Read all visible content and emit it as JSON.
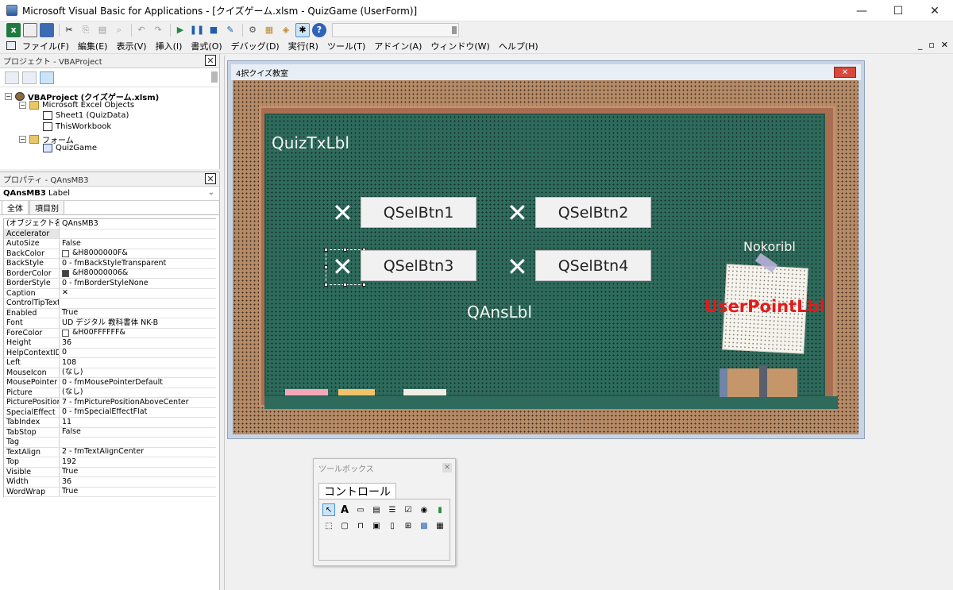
{
  "window": {
    "title": "Microsoft Visual Basic for Applications - [クイズゲーム.xlsm - QuizGame (UserForm)]",
    "controls": [
      "—",
      "☐",
      "✕"
    ]
  },
  "menu": {
    "items": [
      "ファイル(F)",
      "編集(E)",
      "表示(V)",
      "挿入(I)",
      "書式(O)",
      "デバッグ(D)",
      "実行(R)",
      "ツール(T)",
      "アドイン(A)",
      "ウィンドウ(W)",
      "ヘルプ(H)"
    ],
    "mdi_controls": [
      "_",
      "▫",
      "✕"
    ]
  },
  "project": {
    "title": "プロジェクト - VBAProject",
    "close": "✕",
    "root": "VBAProject (クイズゲーム.xlsm)",
    "excel_objects": "Microsoft Excel Objects",
    "sheet1": "Sheet1 (QuizData)",
    "workbook": "ThisWorkbook",
    "forms_folder": "フォーム",
    "form": "QuizGame"
  },
  "properties": {
    "title": "プロパティ - QAnsMB3",
    "close": "✕",
    "object_name": "QAnsMB3",
    "object_type": "Label",
    "tabs": [
      "全体",
      "項目別"
    ],
    "rows": [
      {
        "name": "(オブジェクト名)",
        "value": "QAnsMB3"
      },
      {
        "name": "Accelerator",
        "value": ""
      },
      {
        "name": "AutoSize",
        "value": "False"
      },
      {
        "name": "BackColor",
        "value": "&H8000000F&",
        "swatch": "#ffffff"
      },
      {
        "name": "BackStyle",
        "value": "0 - fmBackStyleTransparent"
      },
      {
        "name": "BorderColor",
        "value": "&H80000006&",
        "swatch": "#444444"
      },
      {
        "name": "BorderStyle",
        "value": "0 - fmBorderStyleNone"
      },
      {
        "name": "Caption",
        "value": "✕"
      },
      {
        "name": "ControlTipText",
        "value": ""
      },
      {
        "name": "Enabled",
        "value": "True"
      },
      {
        "name": "Font",
        "value": "UD デジタル 教科書体 NK-B"
      },
      {
        "name": "ForeColor",
        "value": "&H00FFFFFF&",
        "swatch": "#ffffff"
      },
      {
        "name": "Height",
        "value": "36"
      },
      {
        "name": "HelpContextID",
        "value": "0"
      },
      {
        "name": "Left",
        "value": "108"
      },
      {
        "name": "MouseIcon",
        "value": "(なし)"
      },
      {
        "name": "MousePointer",
        "value": "0 - fmMousePointerDefault"
      },
      {
        "name": "Picture",
        "value": "(なし)"
      },
      {
        "name": "PicturePosition",
        "value": "7 - fmPicturePositionAboveCenter"
      },
      {
        "name": "SpecialEffect",
        "value": "0 - fmSpecialEffectFlat"
      },
      {
        "name": "TabIndex",
        "value": "11"
      },
      {
        "name": "TabStop",
        "value": "False"
      },
      {
        "name": "Tag",
        "value": ""
      },
      {
        "name": "TextAlign",
        "value": "2 - fmTextAlignCenter"
      },
      {
        "name": "Top",
        "value": "192"
      },
      {
        "name": "Visible",
        "value": "True"
      },
      {
        "name": "Width",
        "value": "36"
      },
      {
        "name": "WordWrap",
        "value": "True"
      }
    ]
  },
  "designer": {
    "title": "4択クイズ教室",
    "close": "✕",
    "quiz_label": "QuizTxLbl",
    "answer_label": "QAnsLbl",
    "mark": "✕",
    "buttons": [
      "QSelBtn1",
      "QSelBtn2",
      "QSelBtn3",
      "QSelBtn4"
    ],
    "nokori_label": "Nokoribl",
    "user_point_label": "UserPointLbl",
    "colors": {
      "board": "#2f6b5c",
      "frame": "#a86e52",
      "user_point": "#e21b1b"
    }
  },
  "toolbox": {
    "title": "ツールボックス",
    "close": "✕",
    "tab": "コントロール",
    "controls_row1": [
      "pointer-icon",
      "label-icon",
      "textbox-icon",
      "combobox-icon",
      "listbox-icon",
      "checkbox-icon",
      "optionbutton-icon",
      "togglebutton-icon"
    ],
    "controls_row2": [
      "frame-icon",
      "commandbutton-icon",
      "tabstrip-icon",
      "multipage-icon",
      "scrollbar-icon",
      "spinbutton-icon",
      "image-icon",
      "refedit-icon"
    ]
  }
}
